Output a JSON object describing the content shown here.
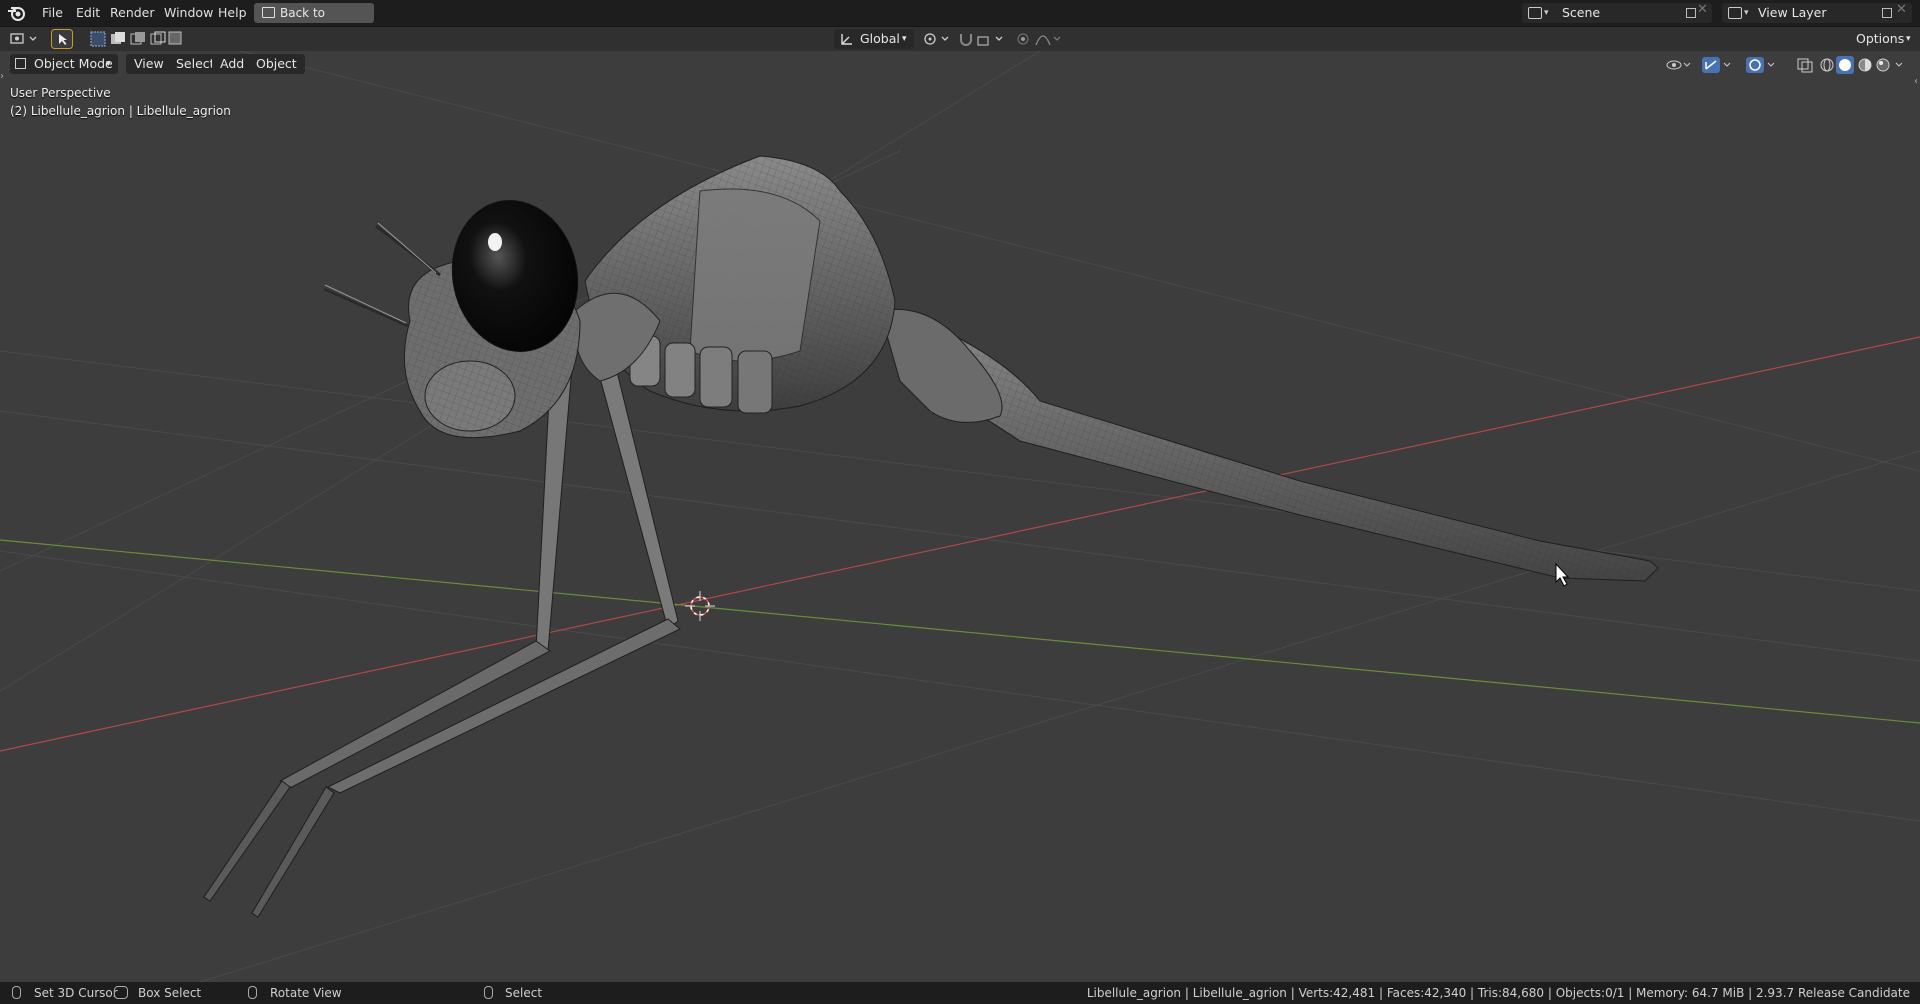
{
  "topbar": {
    "menus": [
      "File",
      "Edit",
      "Render",
      "Window",
      "Help"
    ],
    "back_button": "Back to Previous",
    "scene": "Scene",
    "view_layer": "View Layer"
  },
  "header": {
    "transform_orientation": "Global",
    "options": "Options"
  },
  "viewport_header": {
    "mode": "Object Mode",
    "menus": [
      "View",
      "Select",
      "Add",
      "Object"
    ]
  },
  "viewport": {
    "perspective": "User Perspective",
    "object_info": "(2) Libellule_agrion | Libellule_agrion"
  },
  "status": {
    "left_items": [
      {
        "icon": "mouse-left-icon",
        "label": "Set 3D Cursor"
      },
      {
        "icon": "mouse-left-drag-icon",
        "label": "Box Select"
      },
      {
        "icon": "mouse-middle-icon",
        "label": "Rotate View"
      },
      {
        "icon": "mouse-right-icon",
        "label": "Select"
      }
    ],
    "right_text": "Libellule_agrion | Libellule_agrion | Verts:42,481 | Faces:42,340 | Tris:84,680 | Objects:0/1 | Memory: 64.7 MiB | 2.93.7 Release Candidate"
  },
  "colors": {
    "topbar_bg": "#1d1d1d",
    "viewport_bg": "#3d3d3d",
    "x_axis": "#c04a4a",
    "y_axis": "#6e8a3a",
    "accent_blue": "#4772b3"
  }
}
